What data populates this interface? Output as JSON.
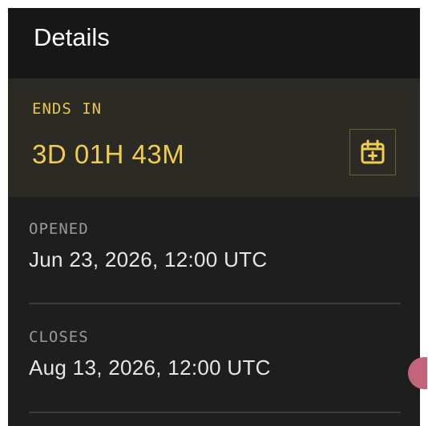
{
  "header": {
    "title": "Details"
  },
  "ends": {
    "label": "ENDS IN",
    "value": "3D 01H 43M",
    "calendar_icon": "calendar-plus-icon",
    "accent_color": "#f0cd4f"
  },
  "opened": {
    "label": "OPENED",
    "value": "Jun 23, 2026, 12:00 UTC"
  },
  "closes": {
    "label": "CLOSES",
    "value": "Aug 13, 2026, 12:00 UTC"
  }
}
